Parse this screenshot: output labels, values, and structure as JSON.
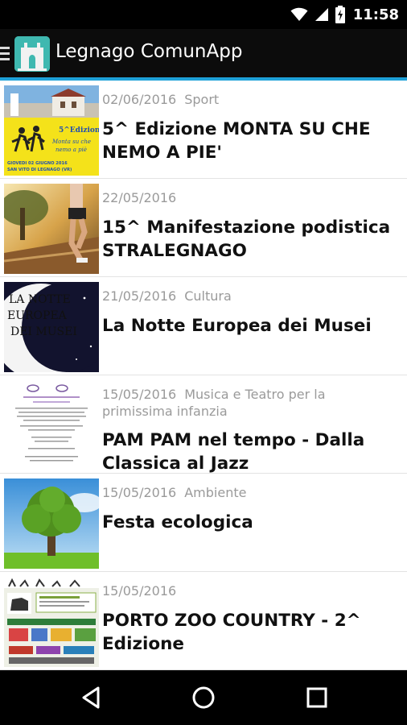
{
  "status": {
    "time": "11:58"
  },
  "app": {
    "title": "Legnago ComunApp"
  },
  "items": [
    {
      "date": "02/06/2016",
      "category": "Sport",
      "title": "5^ Edizione MONTA SU CHE NEMO A PIE'",
      "thumb_text": "GIOVEDI 02 GIUGNO 2016 SAN VITO DI LEGNAGO (VR)"
    },
    {
      "date": "22/05/2016",
      "category": "",
      "title": "15^ Manifestazione podistica STRALEGNAGO"
    },
    {
      "date": "21/05/2016",
      "category": "Cultura",
      "title": "La Notte Europea dei Musei",
      "thumb_text": "LA NOTTE EUROPEA DEI MUSEI"
    },
    {
      "date": "15/05/2016",
      "category": "Musica e Teatro per la primissima infanzia",
      "title": "PAM PAM nel tempo - Dalla Classica al Jazz"
    },
    {
      "date": "15/05/2016",
      "category": "Ambiente",
      "title": "Festa ecologica"
    },
    {
      "date": "15/05/2016",
      "category": "",
      "title": "PORTO ZOO COUNTRY - 2^ Edizione"
    }
  ]
}
